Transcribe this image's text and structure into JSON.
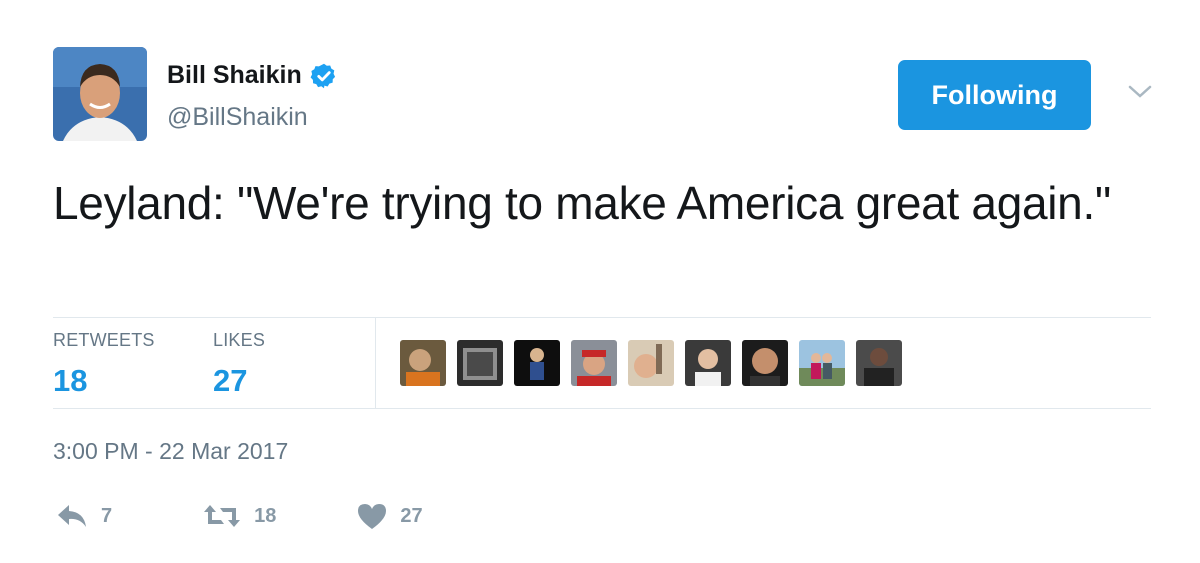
{
  "author": {
    "display_name": "Bill Shaikin",
    "handle": "@BillShaikin",
    "verified_icon": "verified-badge-icon",
    "avatar_icon": "profile-photo"
  },
  "follow_button": {
    "label": "Following",
    "color": "#1b95e0"
  },
  "caret_icon": "chevron-down-icon",
  "tweet": {
    "text": "Leyland: \"We're trying to make America great again.\""
  },
  "stats": {
    "retweets_label": "RETWEETS",
    "retweets_count": "18",
    "likes_label": "LIKES",
    "likes_count": "27"
  },
  "likers_count_shown": 9,
  "timestamp": "3:00 PM - 22 Mar 2017",
  "actions": {
    "reply_count": "7",
    "retweet_count": "18",
    "like_count": "27",
    "reply_icon": "reply-icon",
    "retweet_icon": "retweet-icon",
    "like_icon": "heart-icon"
  },
  "colors": {
    "accent": "#1b95e0",
    "secondary_text": "#657786",
    "action_gray": "#8899a6",
    "divider": "#e1e8ed"
  }
}
